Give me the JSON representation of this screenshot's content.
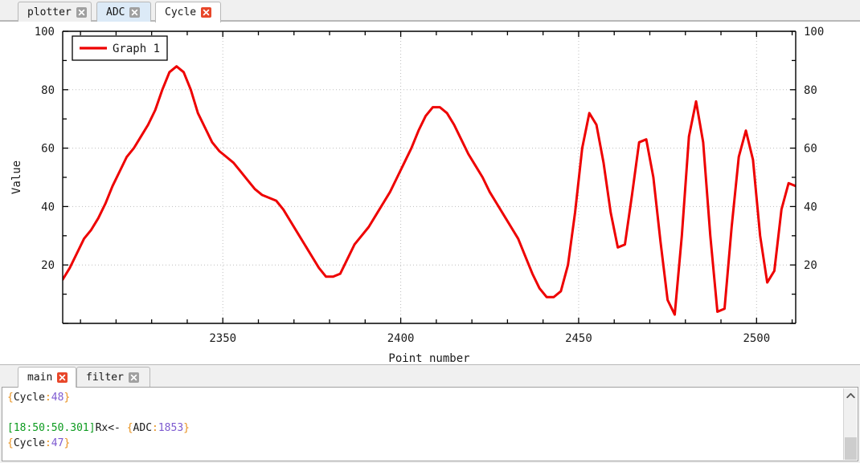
{
  "plot_tabs": [
    {
      "label": "plotter",
      "active": false,
      "hover": false,
      "close_color": "#a0a0a0"
    },
    {
      "label": "ADC",
      "active": false,
      "hover": true,
      "close_color": "#a0a0a0"
    },
    {
      "label": "Cycle",
      "active": true,
      "hover": false,
      "close_color": "#e8472a"
    }
  ],
  "console_tabs": [
    {
      "label": "main",
      "active": true,
      "close_color": "#e8472a"
    },
    {
      "label": "filter",
      "active": false,
      "close_color": "#a0a0a0"
    }
  ],
  "console": {
    "lines": [
      {
        "type": "kv",
        "brace_open": "{",
        "key": "Cycle",
        "colon": ":",
        "value": "48",
        "brace_close": "}"
      },
      {
        "type": "blank"
      },
      {
        "type": "rx",
        "timestamp": "[18:50:50.301]",
        "direction": "Rx<-",
        "space": " ",
        "brace_open": "{",
        "key": "ADC",
        "colon": ":",
        "value": "1853",
        "brace_close": "}"
      },
      {
        "type": "kv",
        "brace_open": "{",
        "key": "Cycle",
        "colon": ":",
        "value": "47",
        "brace_close": "}"
      }
    ]
  },
  "scrollbar": {
    "up_arrow": "chevron-up-icon"
  },
  "chart_data": {
    "type": "line",
    "title": "",
    "xlabel": "Point number",
    "ylabel": "Value",
    "legend": [
      {
        "name": "Graph 1",
        "color": "#ee0000"
      }
    ],
    "legend_position": "top-left",
    "grid": true,
    "xlim": [
      2305,
      2511
    ],
    "ylim": [
      0,
      100
    ],
    "xticks": [
      2350,
      2400,
      2450,
      2500
    ],
    "yticks": [
      20,
      40,
      60,
      80,
      100
    ],
    "y_axis_right_mirror": true,
    "line_color": "#ee0000",
    "line_width": 3,
    "series": [
      {
        "name": "Graph 1",
        "x": [
          2305,
          2307,
          2309,
          2311,
          2313,
          2315,
          2317,
          2319,
          2321,
          2323,
          2325,
          2327,
          2329,
          2331,
          2333,
          2335,
          2337,
          2339,
          2341,
          2343,
          2345,
          2347,
          2349,
          2351,
          2353,
          2355,
          2357,
          2359,
          2361,
          2363,
          2365,
          2367,
          2369,
          2371,
          2373,
          2375,
          2377,
          2379,
          2381,
          2383,
          2385,
          2387,
          2389,
          2391,
          2393,
          2395,
          2397,
          2399,
          2401,
          2403,
          2405,
          2407,
          2409,
          2411,
          2413,
          2415,
          2417,
          2419,
          2421,
          2423,
          2425,
          2427,
          2429,
          2431,
          2433,
          2435,
          2437,
          2439,
          2441,
          2443,
          2445,
          2447,
          2449,
          2451,
          2453,
          2455,
          2457,
          2459,
          2461,
          2463,
          2465,
          2467,
          2469,
          2471,
          2473,
          2475,
          2477,
          2479,
          2481,
          2483,
          2485,
          2487,
          2489,
          2491,
          2493,
          2495,
          2497,
          2499,
          2501,
          2503,
          2505,
          2507,
          2509,
          2511
        ],
        "y": [
          15,
          19,
          24,
          29,
          32,
          36,
          41,
          47,
          52,
          57,
          60,
          64,
          68,
          73,
          80,
          86,
          88,
          86,
          80,
          72,
          67,
          62,
          59,
          57,
          55,
          52,
          49,
          46,
          44,
          43,
          42,
          39,
          35,
          31,
          27,
          23,
          19,
          16,
          16,
          17,
          22,
          27,
          30,
          33,
          37,
          41,
          45,
          50,
          55,
          60,
          66,
          71,
          74,
          74,
          72,
          68,
          63,
          58,
          54,
          50,
          45,
          41,
          37,
          33,
          29,
          23,
          17,
          12,
          9,
          9,
          11,
          20,
          38,
          60,
          72,
          68,
          55,
          38,
          26,
          27,
          44,
          62,
          63,
          50,
          28,
          8,
          3,
          30,
          64,
          76,
          62,
          30,
          4,
          5,
          33,
          57,
          66,
          56,
          30,
          14,
          18,
          39,
          48,
          47
        ]
      }
    ]
  }
}
